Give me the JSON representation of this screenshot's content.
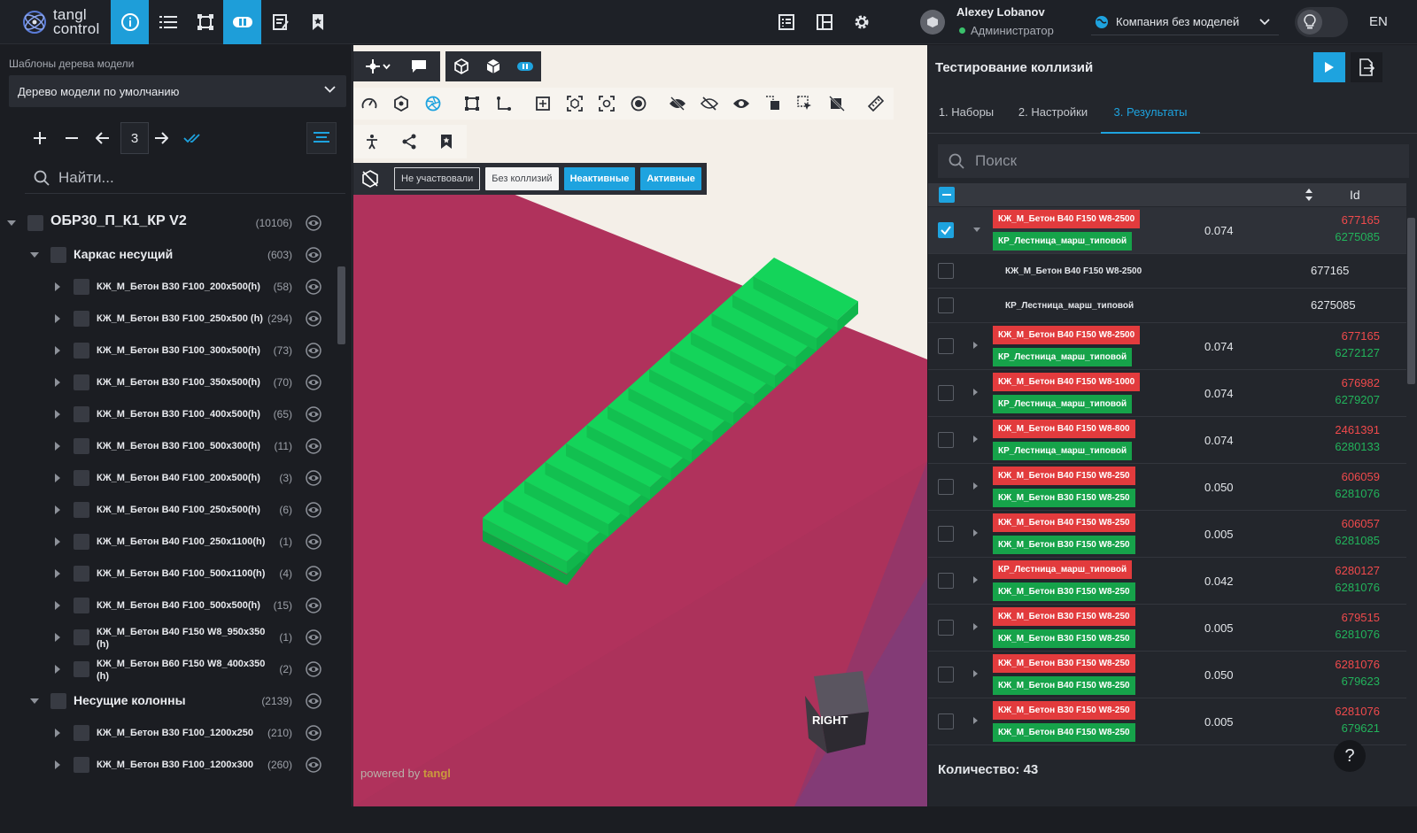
{
  "app": {
    "logo_line1": "tangl",
    "logo_line2": "control"
  },
  "user": {
    "name": "Alexey Lobanov",
    "role": "Администратор"
  },
  "company": {
    "name": "Компания без моделей"
  },
  "lang": "EN",
  "left_panel": {
    "template_label": "Шаблоны дерева модели",
    "template_value": "Дерево модели по умолчанию",
    "level_value": "3",
    "search_placeholder": "Найти..."
  },
  "tree": [
    {
      "label": "ОБР30_П_К1_КР V2",
      "count": "(10106)",
      "level": 0
    },
    {
      "label": "Каркас несущий",
      "count": "(603)",
      "level": 1
    },
    {
      "label": "КЖ_М_Бетон В30 F100_200x500(h)",
      "count": "(58)",
      "level": 2
    },
    {
      "label": "КЖ_М_Бетон В30 F100_250x500 (h)",
      "count": "(294)",
      "level": 2
    },
    {
      "label": "КЖ_М_Бетон В30 F100_300x500(h)",
      "count": "(73)",
      "level": 2
    },
    {
      "label": "КЖ_М_Бетон В30 F100_350x500(h)",
      "count": "(70)",
      "level": 2
    },
    {
      "label": "КЖ_М_Бетон В30 F100_400x500(h)",
      "count": "(65)",
      "level": 2
    },
    {
      "label": "КЖ_М_Бетон В30 F100_500x300(h)",
      "count": "(11)",
      "level": 2
    },
    {
      "label": "КЖ_М_Бетон В40 F100_200x500(h)",
      "count": "(3)",
      "level": 2
    },
    {
      "label": "КЖ_М_Бетон В40 F100_250x500(h)",
      "count": "(6)",
      "level": 2
    },
    {
      "label": "КЖ_М_Бетон В40 F100_250x1100(h)",
      "count": "(1)",
      "level": 2
    },
    {
      "label": "КЖ_М_Бетон В40 F100_500x1100(h)",
      "count": "(4)",
      "level": 2
    },
    {
      "label": "КЖ_М_Бетон В40 F100_500x500(h)",
      "count": "(15)",
      "level": 2
    },
    {
      "label": "КЖ_М_Бетон В40 F150 W8_950x350 (h)",
      "count": "(1)",
      "level": 2
    },
    {
      "label": "КЖ_М_Бетон В60 F150 W8_400x350 (h)",
      "count": "(2)",
      "level": 2
    },
    {
      "label": "Несущие колонны",
      "count": "(2139)",
      "level": 1
    },
    {
      "label": "КЖ_М_Бетон В30 F100_1200x250",
      "count": "(210)",
      "level": 2
    },
    {
      "label": "КЖ_М_Бетон В30 F100_1200x300",
      "count": "(260)",
      "level": 2
    }
  ],
  "viewer": {
    "filters": {
      "not_participated": "Не участвовали",
      "no_collisions": "Без коллизий",
      "inactive": "Неактивные",
      "active": "Активные"
    },
    "powered_prefix": "powered by ",
    "powered_brand": "tangl",
    "cube_face": "RIGHT"
  },
  "right_panel": {
    "title": "Тестирование коллизий",
    "tabs": [
      "1. Наборы",
      "2. Настройки",
      "3. Результаты"
    ],
    "active_tab": 2,
    "search_placeholder": "Поиск",
    "col_id": "Id",
    "count_text": "Количество: 43"
  },
  "results": [
    {
      "kind": "pair",
      "checked": true,
      "expanded": true,
      "a": "КЖ_М_Бетон В40 F150 W8-2500",
      "a_color": "red",
      "b": "КР_Лестница_марш_типовой",
      "b_color": "green",
      "value": "0.074",
      "id1": "677165",
      "id2": "6275085"
    },
    {
      "kind": "sub",
      "name": "КЖ_М_Бетон В40 F150 W8-2500",
      "id": "677165"
    },
    {
      "kind": "sub",
      "name": "КР_Лестница_марш_типовой",
      "id": "6275085"
    },
    {
      "kind": "pair",
      "a": "КЖ_М_Бетон В40 F150 W8-2500",
      "a_color": "red",
      "b": "КР_Лестница_марш_типовой",
      "b_color": "green",
      "value": "0.074",
      "id1": "677165",
      "id2": "6272127"
    },
    {
      "kind": "pair",
      "a": "КЖ_М_Бетон В40 F150 W8-1000",
      "a_color": "red",
      "b": "КР_Лестница_марш_типовой",
      "b_color": "green",
      "value": "0.074",
      "id1": "676982",
      "id2": "6279207"
    },
    {
      "kind": "pair",
      "a": "КЖ_М_Бетон В40 F150 W8-800",
      "a_color": "red",
      "b": "КР_Лестница_марш_типовой",
      "b_color": "green",
      "value": "0.074",
      "id1": "2461391",
      "id2": "6280133"
    },
    {
      "kind": "pair",
      "a": "КЖ_М_Бетон В40 F150 W8-250",
      "a_color": "red",
      "b": "КЖ_М_Бетон В30 F150 W8-250",
      "b_color": "green",
      "value": "0.050",
      "id1": "606059",
      "id2": "6281076"
    },
    {
      "kind": "pair",
      "a": "КЖ_М_Бетон В40 F150 W8-250",
      "a_color": "red",
      "b": "КЖ_М_Бетон В30 F150 W8-250",
      "b_color": "green",
      "value": "0.005",
      "id1": "606057",
      "id2": "6281085"
    },
    {
      "kind": "pair",
      "a": "КР_Лестница_марш_типовой",
      "a_color": "red",
      "b": "КЖ_М_Бетон В30 F150 W8-250",
      "b_color": "green",
      "value": "0.042",
      "id1": "6280127",
      "id2": "6281076"
    },
    {
      "kind": "pair",
      "a": "КЖ_М_Бетон В30 F150 W8-250",
      "a_color": "red",
      "b": "КЖ_М_Бетон В30 F150 W8-250",
      "b_color": "green",
      "value": "0.005",
      "id1": "679515",
      "id2": "6281076"
    },
    {
      "kind": "pair",
      "a": "КЖ_М_Бетон В30 F150 W8-250",
      "a_color": "red",
      "b": "КЖ_М_Бетон В40 F150 W8-250",
      "b_color": "green",
      "value": "0.050",
      "id1": "6281076",
      "id2": "679623"
    },
    {
      "kind": "pair",
      "a": "КЖ_М_Бетон В30 F150 W8-250",
      "a_color": "red",
      "b": "КЖ_М_Бетон В40 F150 W8-250",
      "b_color": "green",
      "value": "0.005",
      "id1": "6281076",
      "id2": "679621"
    }
  ],
  "colors": {
    "accent": "#1ea3df",
    "collision_red": "#e23b3d",
    "collision_green": "#16a34a",
    "stair_green": "#14d45a",
    "floor_red": "#b0325c"
  },
  "icons": {
    "topbar": [
      "info-icon",
      "list-icon",
      "frame-icon",
      "view-icon",
      "checklist-icon",
      "bookmark-icon",
      "report-icon",
      "layout-icon",
      "settings-icon"
    ],
    "viewer_tools": [
      "navigation-icon",
      "comment-icon",
      "box-icon",
      "solid-box-icon",
      "view-mode-icon",
      "speed-icon",
      "hex-icon",
      "aperture-icon",
      "section-box-icon",
      "axis-icon",
      "fit-icon",
      "focus-icon",
      "zoom-select-icon",
      "target-icon",
      "hide-icon",
      "hide-others-icon",
      "show-icon",
      "isolate-icon",
      "select-icon",
      "hide-selected-icon",
      "ruler-icon",
      "walk-icon",
      "share-icon",
      "bookmark-icon"
    ]
  }
}
